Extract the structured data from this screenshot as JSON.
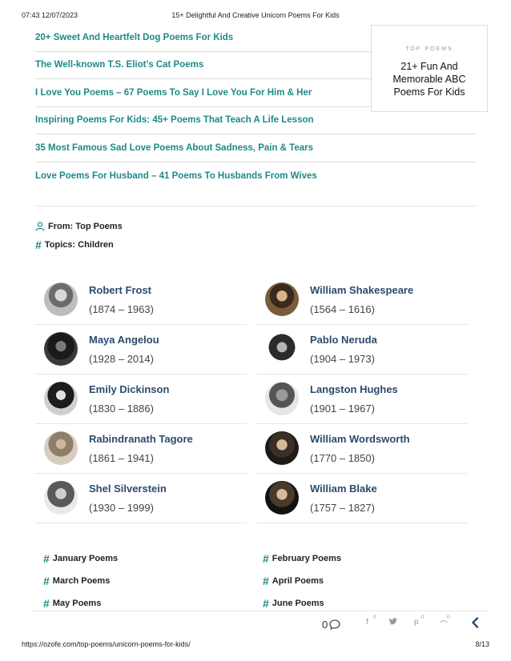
{
  "print_header": {
    "timestamp": "07:43 12/07/2023",
    "title": "15+ Delightful And Creative Unicorn Poems For Kids"
  },
  "print_footer": {
    "url": "https://ozofe.com/top-poems/unicorn-poems-for-kids/",
    "page": "8/13"
  },
  "related_links": [
    "20+ Sweet And Heartfelt Dog Poems For Kids",
    "The Well-known T.S. Eliot’s Cat Poems",
    "I Love You Poems – 67 Poems To Say I Love You For Him & Her",
    "Inspiring Poems For Kids: 45+ Poems That Teach A Life Lesson",
    "35 Most Famous Sad Love Poems About Sadness, Pain & Tears",
    "Love Poems For Husband – 41 Poems To Husbands From Wives"
  ],
  "top_poems": {
    "label": "TOP POEMS",
    "title": "21+ Fun And Memorable ABC Poems For Kids"
  },
  "meta": {
    "from": "From: Top Poems",
    "topics": "Topics: Children"
  },
  "poets": [
    {
      "name": "Robert Frost",
      "years": "(1874 – 1963)"
    },
    {
      "name": "William Shakespeare",
      "years": "(1564 – 1616)"
    },
    {
      "name": "Maya Angelou",
      "years": "(1928 – 2014)"
    },
    {
      "name": "Pablo Neruda",
      "years": "(1904 – 1973)"
    },
    {
      "name": "Emily Dickinson",
      "years": "(1830 – 1886)"
    },
    {
      "name": "Langston Hughes",
      "years": "(1901 – 1967)"
    },
    {
      "name": "Rabindranath Tagore",
      "years": "(1861 – 1941)"
    },
    {
      "name": "William Wordsworth",
      "years": "(1770 – 1850)"
    },
    {
      "name": "Shel Silverstein",
      "years": "(1930 – 1999)"
    },
    {
      "name": "William Blake",
      "years": "(1757 – 1827)"
    }
  ],
  "months": [
    "January Poems",
    "February Poems",
    "March Poems",
    "April Poems",
    "May Poems",
    "June Poems"
  ],
  "share": {
    "comments": "0",
    "counts": [
      "0",
      "0",
      "0"
    ]
  },
  "colors": {
    "link": "#1d8a86",
    "poet_name": "#2c4a6e"
  }
}
